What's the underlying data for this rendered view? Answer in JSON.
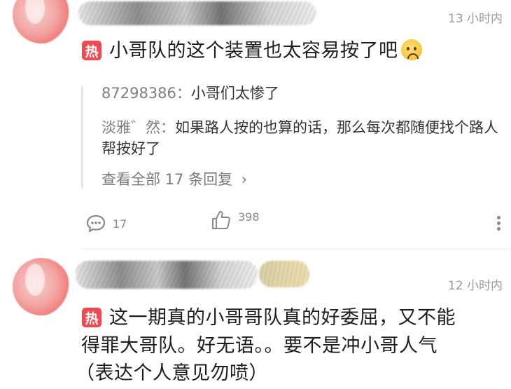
{
  "comments": [
    {
      "time": "13 小时内",
      "hot_badge": "热",
      "text": "小哥队的这个装置也太容易按了吧",
      "emoji": "sad-face-emoji",
      "replies": [
        {
          "name": "87298386",
          "sep": "：",
          "text": "小哥们太惨了"
        },
        {
          "name": "淡雅゛然",
          "sep": "：",
          "text": "如果路人按的也算的话，那么每次都随便找个路人帮按好了"
        }
      ],
      "view_all": "查看全部 17 条回复",
      "view_all_arrow": "›",
      "comment_count": "17",
      "like_count": "398"
    },
    {
      "time": "12 小时内",
      "hot_badge": "热",
      "text_line1": "这一期真的小哥哥队真的好委屈，又不能",
      "text_line2": "得罪大哥队。好无语。。要不是冲小哥人气",
      "text_line3": "（表达个人意见勿喷）"
    }
  ],
  "colors": {
    "hot_badge": "#f0494f",
    "timestamp": "#9a9a9a",
    "reply_name": "#7f7f7f",
    "icon_gray": "#8a8a8a"
  }
}
